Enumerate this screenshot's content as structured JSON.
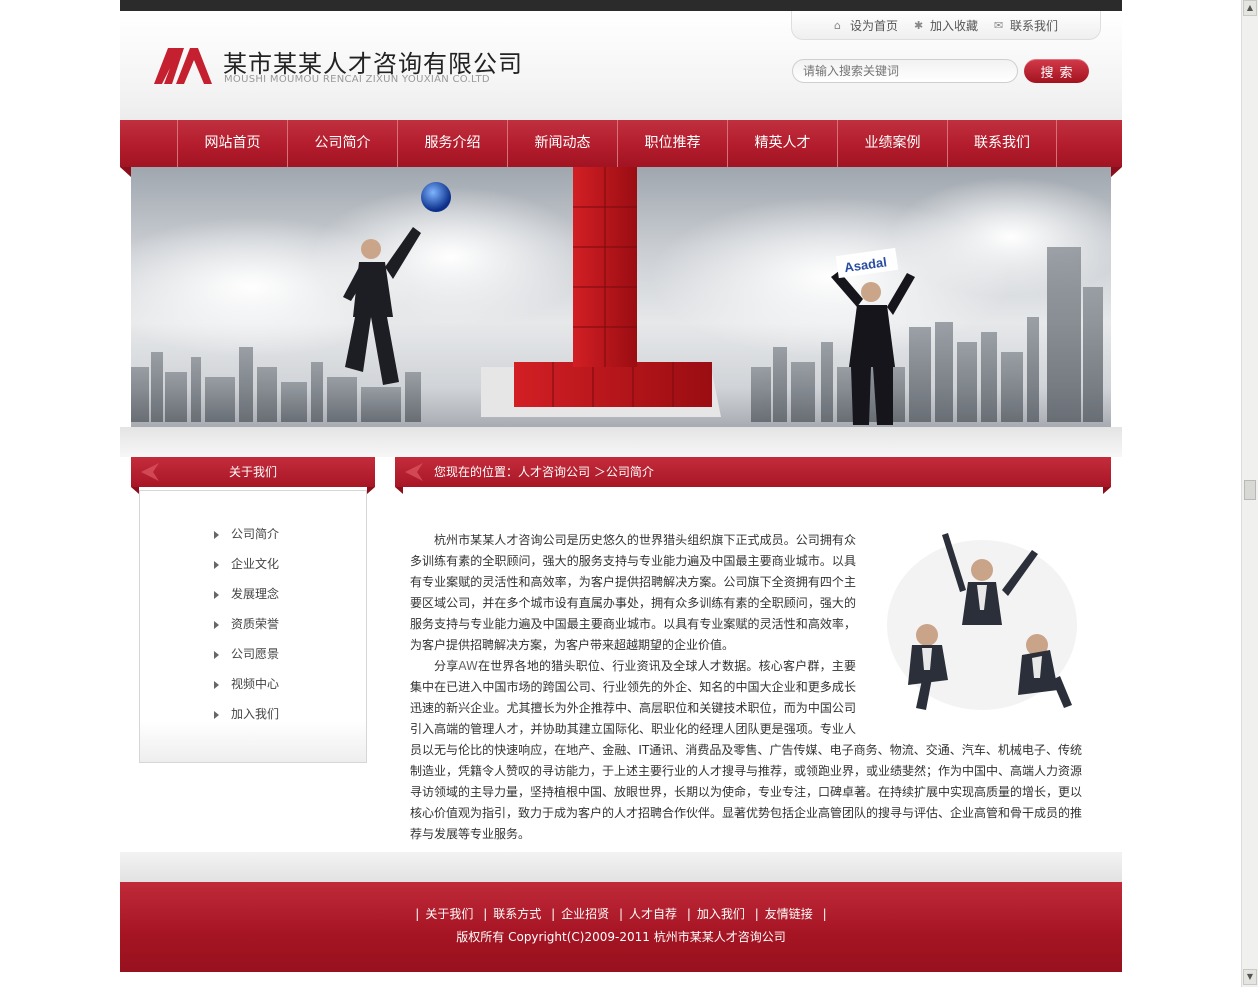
{
  "header": {
    "company_name": "某市某某人才咨询有限公司",
    "company_name_en": "MOUSHI MOUMOU RENCAI ZIXUN YOUXIAN CO.LTD",
    "top_links": [
      {
        "label": "设为首页",
        "icon": "home-icon"
      },
      {
        "label": "加入收藏",
        "icon": "star-icon"
      },
      {
        "label": "联系我们",
        "icon": "mail-icon"
      }
    ],
    "search_placeholder": "请输入搜索关键词",
    "search_button": "搜索"
  },
  "nav": {
    "items": [
      "网站首页",
      "公司简介",
      "服务介绍",
      "新闻动态",
      "职位推荐",
      "精英人才",
      "业绩案例",
      "联系我们"
    ]
  },
  "banner": {
    "sign_text": "Asadal"
  },
  "sidebar": {
    "title": "关于我们",
    "items": [
      "公司简介",
      "企业文化",
      "发展理念",
      "资质荣誉",
      "公司愿景",
      "视频中心",
      "加入我们"
    ]
  },
  "main": {
    "breadcrumb": "您现在的位置：人才咨询公司 ＞公司简介",
    "para1": "杭州市某某人才咨询公司是历史悠久的世界猎头组织旗下正式成员。公司拥有众多训练有素的全职顾问，强大的服务支持与专业能力遍及中国最主要商业城市。以具有专业案赋的灵活性和高效率，为客户提供招聘解决方案。公司旗下全资拥有四个主要区域公司，并在多个城市设有直属办事处，拥有众多训练有素的全职顾问，强大的服务支持与专业能力遍及中国最主要商业城市。以具有专业案赋的灵活性和高效率，为客户提供招聘解决方案，为客户带来超越期望的企业价值。",
    "para2_a": "分享",
    "para2_hl": "AW",
    "para2_b": "在世界各地的猎头职位、行业资讯及全球人才数据。核心客户群，主要集中在已进入中国市场的跨国公司、行业领先的外企、知名的中国大企业和更多成长迅速的新兴企业。尤其擅长为外企推荐中、高层职位和关键技术职位，而为中国公司引入高端的管理人才，并协助其建立国际化、职业化的经理人团队更是强项。专业人员以无与伦比的快速响应，在地产、金融、IT通讯、消费品及零售、广告传媒、电子商务、物流、交通、汽车、机械电子、传统制造业，凭籍令人赞叹的寻访能力，于上述主要行业的人才搜寻与推荐，或领跑业界，或业绩斐然；作为中国中、高端人力资源寻访领域的主导力量，坚持植根中国、放眼世界，长期以为使命，专业专注，口碑卓著。在持续扩展中实现高质量的增长，更以核心价值观为指引，致力于成为客户的人才招聘合作伙伴。显著优势包括企业高管团队的搜寻与评估、企业高管和骨干成员的推荐与发展等专业服务。"
  },
  "footer": {
    "links": [
      "关于我们",
      "联系方式",
      "企业招贤",
      "人才自荐",
      "加入我们",
      "友情链接"
    ],
    "copyright": "版权所有  Copyright(C)2009-2011 杭州市某某人才咨询公司"
  },
  "colors": {
    "brand_red": "#b31c2c",
    "dark_bar": "#2b2b2b"
  }
}
